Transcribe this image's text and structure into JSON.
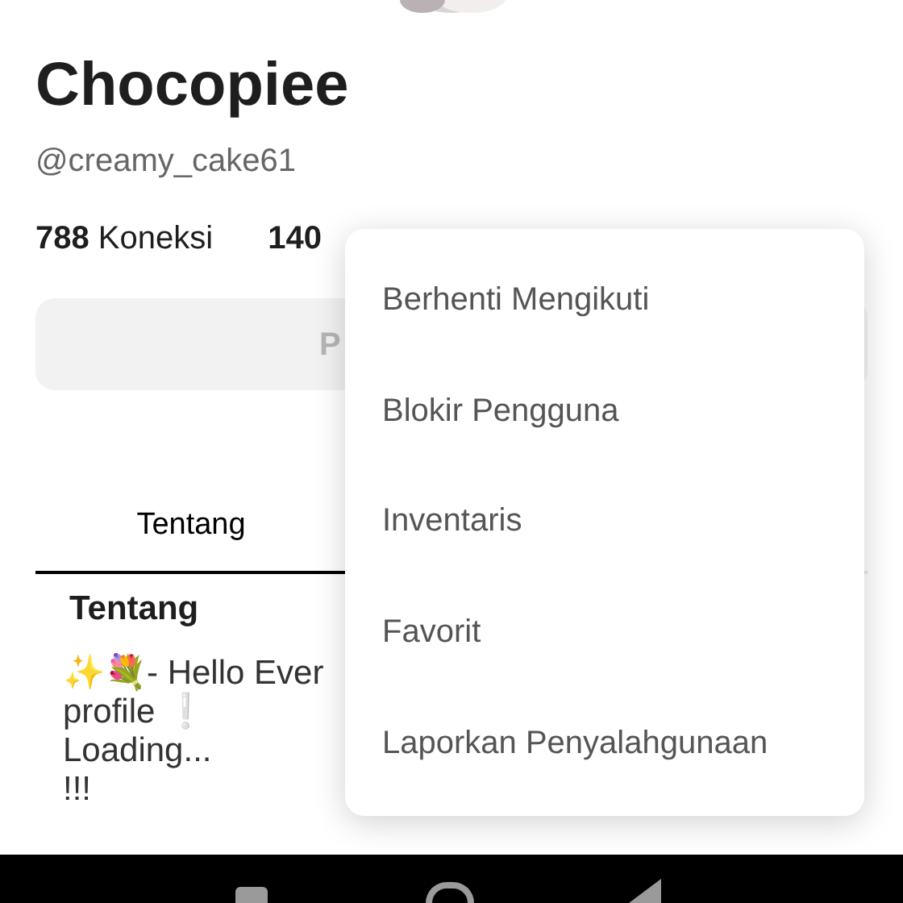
{
  "profile": {
    "name": "Chocopiee",
    "handle": "@creamy_cake61",
    "stats": [
      {
        "value": "788",
        "label": "Koneksi"
      },
      {
        "value": "140"
      }
    ],
    "action_button": "P"
  },
  "tabs": [
    {
      "label": "Tentang",
      "selected": true
    }
  ],
  "about": {
    "heading": "Tentang",
    "lines": [
      "✨💐- Hello Ever",
      "profile ❕",
      "Loading...",
      "!!!"
    ]
  },
  "menu": {
    "items": [
      "Berhenti Mengikuti",
      "Blokir Pengguna",
      "Inventaris",
      "Favorit",
      "Laporkan Penyalahgunaan"
    ]
  }
}
